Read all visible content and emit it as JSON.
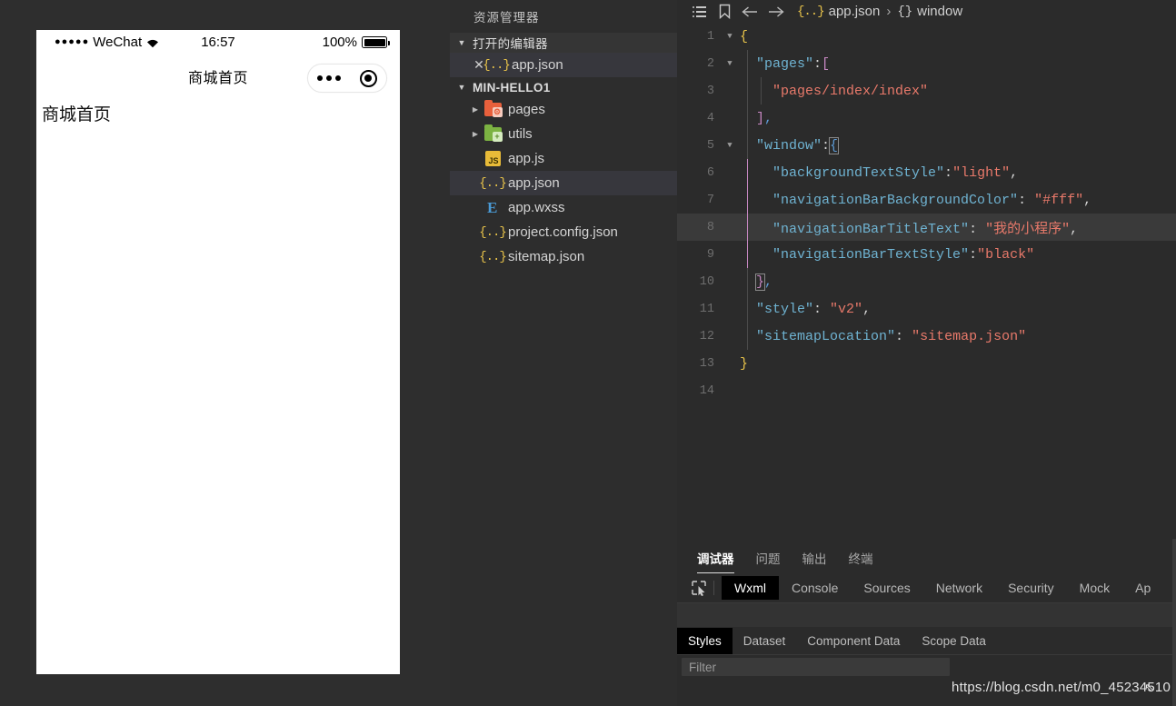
{
  "simulator": {
    "status_bar": {
      "dots": "●●●●●",
      "carrier": "WeChat",
      "time": "16:57",
      "battery_pct": "100%"
    },
    "navbar": {
      "title": "商城首页",
      "capsule_menu_icon": "ellipsis-icon",
      "capsule_target_icon": "target-icon"
    },
    "page_content": "商城首页"
  },
  "explorer": {
    "title": "资源管理器",
    "sections": [
      {
        "label": "打开的编辑器",
        "expanded": true
      },
      {
        "label": "MIN-HELLO1",
        "expanded": true
      }
    ],
    "open_editors": [
      {
        "name": "app.json",
        "icon": "json-icon",
        "close_icon": "close-icon",
        "selected": true
      }
    ],
    "tree": [
      {
        "name": "pages",
        "icon": "folder-orange-icon",
        "badge": "⚙",
        "type": "folder",
        "expanded": false,
        "indent": 1
      },
      {
        "name": "utils",
        "icon": "folder-green-icon",
        "badge": "+",
        "type": "folder",
        "expanded": false,
        "indent": 1
      },
      {
        "name": "app.js",
        "icon": "js-icon",
        "type": "file",
        "indent": 2
      },
      {
        "name": "app.json",
        "icon": "json-icon",
        "type": "file",
        "indent": 2,
        "selected": true
      },
      {
        "name": "app.wxss",
        "icon": "css-icon",
        "type": "file",
        "indent": 2
      },
      {
        "name": "project.config.json",
        "icon": "json-icon",
        "type": "file",
        "indent": 2
      },
      {
        "name": "sitemap.json",
        "icon": "json-icon",
        "type": "file",
        "indent": 2
      }
    ]
  },
  "editor": {
    "toolbar_icons": [
      "list-icon",
      "bookmark-icon",
      "arrow-left-icon",
      "arrow-right-icon"
    ],
    "breadcrumb": {
      "file_icon": "json-icon",
      "file": "app.json",
      "separator": "›",
      "symbol_icon": "braces-icon",
      "symbol": "window"
    },
    "active_line": 8,
    "total_lines": 14,
    "code_lines": [
      {
        "n": 1,
        "fold": "open",
        "text": "{"
      },
      {
        "n": 2,
        "fold": "open",
        "text": "  \"pages\":["
      },
      {
        "n": 3,
        "fold": "",
        "text": "    \"pages/index/index\""
      },
      {
        "n": 4,
        "fold": "",
        "text": "  ],"
      },
      {
        "n": 5,
        "fold": "open",
        "text": "  \"window\":{"
      },
      {
        "n": 6,
        "fold": "",
        "text": "    \"backgroundTextStyle\":\"light\","
      },
      {
        "n": 7,
        "fold": "",
        "text": "    \"navigationBarBackgroundColor\": \"#fff\","
      },
      {
        "n": 8,
        "fold": "",
        "text": "    \"navigationBarTitleText\": \"我的小程序\","
      },
      {
        "n": 9,
        "fold": "",
        "text": "    \"navigationBarTextStyle\":\"black\""
      },
      {
        "n": 10,
        "fold": "",
        "text": "  },"
      },
      {
        "n": 11,
        "fold": "",
        "text": "  \"style\": \"v2\","
      },
      {
        "n": 12,
        "fold": "",
        "text": "  \"sitemapLocation\": \"sitemap.json\""
      },
      {
        "n": 13,
        "fold": "",
        "text": "}"
      },
      {
        "n": 14,
        "fold": "",
        "text": ""
      }
    ]
  },
  "panel": {
    "tabs": [
      {
        "label": "调试器",
        "active": true
      },
      {
        "label": "问题",
        "active": false
      },
      {
        "label": "输出",
        "active": false
      },
      {
        "label": "终端",
        "active": false
      }
    ],
    "inspect_icon": "inspect-element-icon",
    "devtools_tabs": [
      {
        "label": "Wxml",
        "active": true
      },
      {
        "label": "Console",
        "active": false
      },
      {
        "label": "Sources",
        "active": false
      },
      {
        "label": "Network",
        "active": false
      },
      {
        "label": "Security",
        "active": false
      },
      {
        "label": "Mock",
        "active": false
      },
      {
        "label": "Ap",
        "active": false
      }
    ],
    "style_tabs": [
      {
        "label": "Styles",
        "active": true
      },
      {
        "label": "Dataset",
        "active": false
      },
      {
        "label": "Component Data",
        "active": false
      },
      {
        "label": "Scope Data",
        "active": false
      }
    ],
    "filter_placeholder": "Filter"
  },
  "watermark": {
    "url": "https://blog.csdn.net/m0_45234510",
    "cursor_glyph": "⇖"
  },
  "colors": {
    "editor_bg": "#2b2b2b",
    "sidebar_bg": "#2d2d2d",
    "selection": "#37373d",
    "active_line": "#3a3a3a",
    "json_icon": "#e8c34a",
    "key": "#6fb3d2",
    "string": "#e8796a",
    "folder_orange": "#e8603c",
    "folder_green": "#7cb342",
    "phone_bg": "#ffffff"
  }
}
